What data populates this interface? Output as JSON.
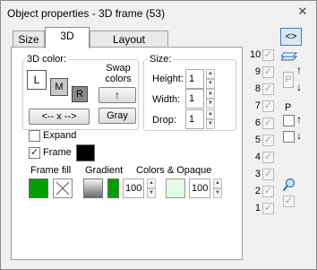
{
  "window": {
    "title": "Object properties - 3D frame (53)",
    "close_glyph": "✕"
  },
  "tabs": [
    {
      "label": "Size",
      "active": false
    },
    {
      "label": "3D",
      "active": true
    },
    {
      "label": "Layout manager",
      "active": false
    }
  ],
  "color3d": {
    "group_label": "3D color:",
    "swatch_l": "L",
    "swatch_m": "M",
    "swatch_r": "R",
    "arrow_button": "<-- x -->",
    "swap_label_1": "Swap",
    "swap_label_2": "colors",
    "swap_button": "↑",
    "gray_button": "Gray"
  },
  "size": {
    "group_label": "Size:",
    "height_label": "Height:",
    "height_value": "1",
    "width_label": "Width:",
    "width_value": "1",
    "drop_label": "Drop:",
    "drop_value": "1"
  },
  "options": {
    "expand_label": "Expand",
    "expand_checked": false,
    "frame_label": "Frame",
    "frame_checked": true,
    "frame_color": "#000000"
  },
  "fill": {
    "frame_fill_label": "Frame fill",
    "gradient_label": "Gradient",
    "colors_opaque_label": "Colors & Opaque",
    "fill_color": "#00a000",
    "gradient_color": "#00a000",
    "opaque_value_1": "100",
    "light_color": "#e3fae3",
    "opaque_value_2": "100"
  },
  "right": {
    "top_button": "<>",
    "levels": [
      "10",
      "9",
      "8",
      "7",
      "6",
      "5",
      "4",
      "3",
      "2",
      "1"
    ],
    "p_label": "P",
    "p_button": "P"
  }
}
